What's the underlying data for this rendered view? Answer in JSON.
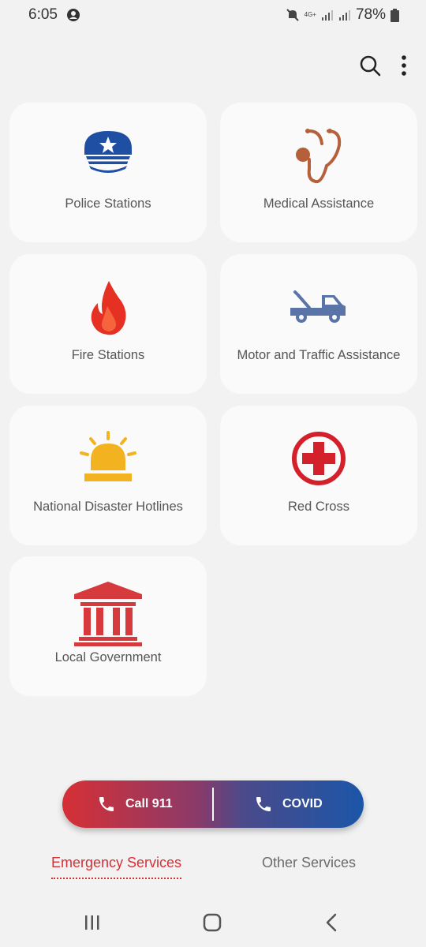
{
  "status_bar": {
    "time": "6:05",
    "network": "4G+",
    "battery": "78%"
  },
  "toolbar": {
    "search_icon": "search-icon",
    "menu_icon": "more-vert-icon"
  },
  "services": [
    {
      "label": "Police Stations",
      "icon": "police-cap-icon",
      "color": "#1f4fa3"
    },
    {
      "label": "Medical Assistance",
      "icon": "stethoscope-icon",
      "color": "#b5603a"
    },
    {
      "label": "Fire Stations",
      "icon": "fire-icon",
      "color": "#e53023"
    },
    {
      "label": "Motor and Traffic Assistance",
      "icon": "tow-truck-icon",
      "color": "#5a74a8"
    },
    {
      "label": "National Disaster Hotlines",
      "icon": "siren-icon",
      "color": "#f3b321"
    },
    {
      "label": "Red Cross",
      "icon": "red-cross-icon",
      "color": "#d4202b"
    },
    {
      "label": "Local Government",
      "icon": "government-building-icon",
      "color": "#d63a3d"
    }
  ],
  "cta": {
    "call_label": "Call 911",
    "covid_label": "COVID",
    "gradient_start": "#d63035",
    "gradient_end": "#1c56a8"
  },
  "tabs": {
    "active": "Emergency Services",
    "other": "Other Services"
  },
  "colors": {
    "accent": "#d63035",
    "card_bg": "#fafafa",
    "page_bg": "#f2f2f2"
  }
}
